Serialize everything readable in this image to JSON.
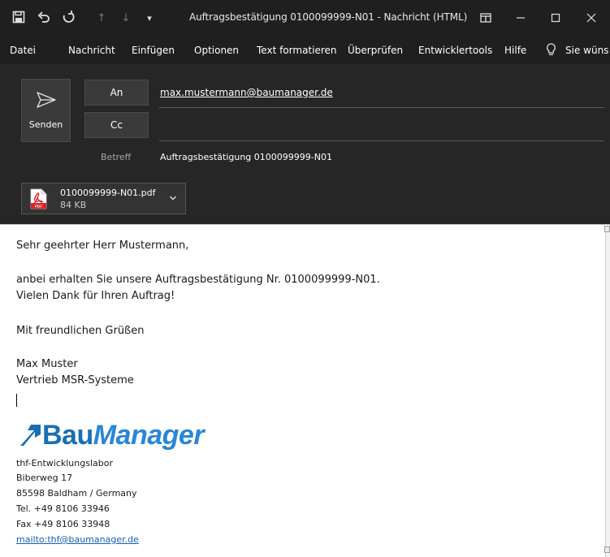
{
  "window": {
    "title": "Auftragsbestätigung 0100099999-N01  -  Nachricht (HTML)"
  },
  "menu": {
    "items": [
      "Datei",
      "Nachricht",
      "Einfügen",
      "Optionen",
      "Text formatieren",
      "Überprüfen",
      "Entwicklertools",
      "Hilfe"
    ],
    "tell_me": "Sie wüns"
  },
  "compose": {
    "send_label": "Senden",
    "to_label": "An",
    "cc_label": "Cc",
    "to_value": "max.mustermann@baumanager.de",
    "subject_label": "Betreff",
    "subject_value": "Auftragsbestätigung 0100099999-N01"
  },
  "attachment": {
    "name": "0100099999-N01.pdf",
    "size": "84 KB",
    "icon_text": "PDF"
  },
  "body": {
    "greeting": "Sehr geehrter Herr Mustermann,",
    "line1": "anbei erhalten Sie unsere Auftragsbestätigung Nr. 0100099999-N01.",
    "line2": "Vielen Dank für Ihren Auftrag!",
    "closing": "Mit freundlichen Grüßen",
    "name": "Max Muster",
    "role": "Vertrieb MSR-Systeme"
  },
  "signature": {
    "logo_part1": "Bau",
    "logo_part2": "Manager",
    "company": "thf-Entwicklungslabor",
    "street": "Biberweg 17",
    "city": "85598 Baldham / Germany",
    "tel": "Tel. +49 8106 33946",
    "fax": "Fax +49 8106 33948",
    "mail": "mailto:thf@baumanager.de"
  },
  "colors": {
    "dark_bg": "#1f1f1f",
    "header_bg": "#262626",
    "logo_blue": "#1a6fb3",
    "link_blue": "#1a5fb4"
  }
}
